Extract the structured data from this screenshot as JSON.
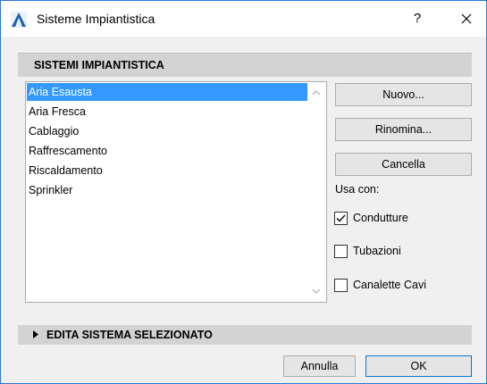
{
  "window": {
    "title": "Sisteme Impiantistica",
    "help_glyph": "?",
    "close_icon": "close-icon"
  },
  "header": {
    "title": "SISTEMI IMPIANTISTICA"
  },
  "list": {
    "items": [
      "Aria Esausta",
      "Aria Fresca",
      "Cablaggio",
      "Raffrescamento",
      "Riscaldamento",
      "Sprinkler"
    ],
    "selected_index": 0
  },
  "buttons": {
    "new": "Nuovo...",
    "rename": "Rinomina...",
    "delete": "Cancella"
  },
  "use_with": {
    "label": "Usa con:",
    "options": [
      {
        "label": "Condutture",
        "checked": true
      },
      {
        "label": "Tubazioni",
        "checked": false
      },
      {
        "label": "Canalette Cavi",
        "checked": false
      }
    ]
  },
  "edit_section": {
    "title": "EDITA SISTEMA SELEZIONATO"
  },
  "footer": {
    "cancel": "Annulla",
    "ok": "OK"
  },
  "colors": {
    "selection": "#3399ff",
    "accent_border": "#2b79d6"
  }
}
